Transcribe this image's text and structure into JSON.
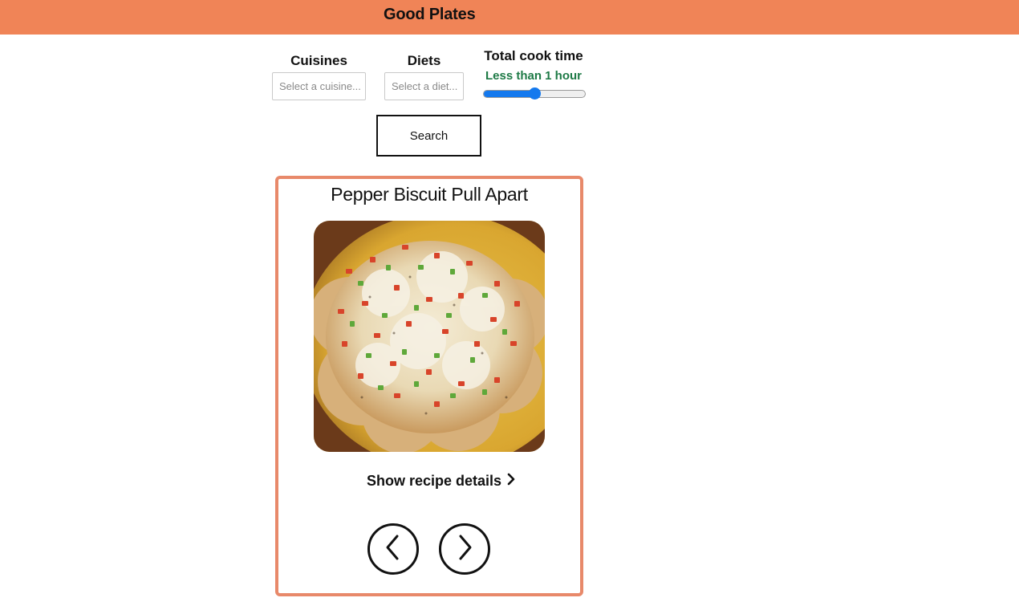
{
  "app": {
    "title": "Good Plates",
    "brand_color": "#f08457"
  },
  "filters": {
    "cuisines": {
      "label": "Cuisines",
      "placeholder": "Select a cuisine..."
    },
    "diets": {
      "label": "Diets",
      "placeholder": "Select a diet..."
    },
    "cook_time": {
      "label": "Total cook time",
      "value_text": "Less than 1 hour",
      "slider_fraction": 0.5,
      "value_color": "#1e7a46",
      "slider_color": "#1479ee"
    },
    "search_label": "Search"
  },
  "recipe_card": {
    "title": "Pepper Biscuit Pull Apart",
    "image": "pepper-biscuit-pull-apart-photo",
    "details_link": "Show recipe details",
    "border_color": "#e8896a",
    "icons": {
      "details": "chevron-right-icon",
      "previous": "chevron-left-icon",
      "next": "chevron-right-icon"
    }
  }
}
